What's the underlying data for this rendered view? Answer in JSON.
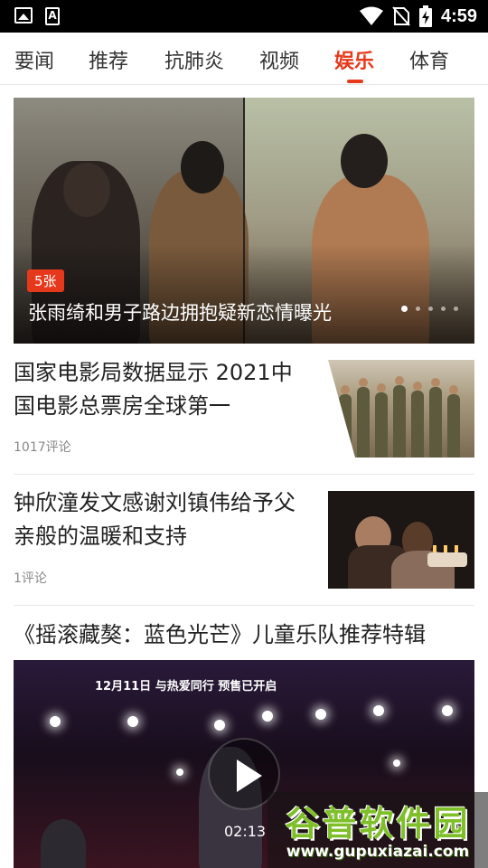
{
  "status_bar": {
    "time": "4:59",
    "icons": [
      "image-icon",
      "font-icon",
      "wifi-icon",
      "no-sim-icon",
      "battery-charging-icon"
    ]
  },
  "tabs": [
    {
      "label": "要闻",
      "active": false
    },
    {
      "label": "推荐",
      "active": false
    },
    {
      "label": "抗肺炎",
      "active": false
    },
    {
      "label": "视频",
      "active": false
    },
    {
      "label": "娱乐",
      "active": true
    },
    {
      "label": "体育",
      "active": false
    }
  ],
  "hero": {
    "badge": "5张",
    "title": "张雨绮和男子路边拥抱疑新恋情曝光",
    "slide_count": 5,
    "active_slide": 1
  },
  "articles": [
    {
      "title": "国家电影局数据显示 2021中国电影总票房全球第一",
      "comments": "1017评论"
    },
    {
      "title": "钟欣潼发文感谢刘镇伟给予父亲般的温暖和支持",
      "comments": "1评论"
    }
  ],
  "video_article": {
    "title": "《摇滚藏獒：蓝色光芒》儿童乐队推荐特辑",
    "duration": "02:13",
    "overlay_text": "12月11日 与热爱同行 预售已开启"
  },
  "watermark": {
    "name": "谷普软件园",
    "url": "www.gupuxiazai.com"
  }
}
